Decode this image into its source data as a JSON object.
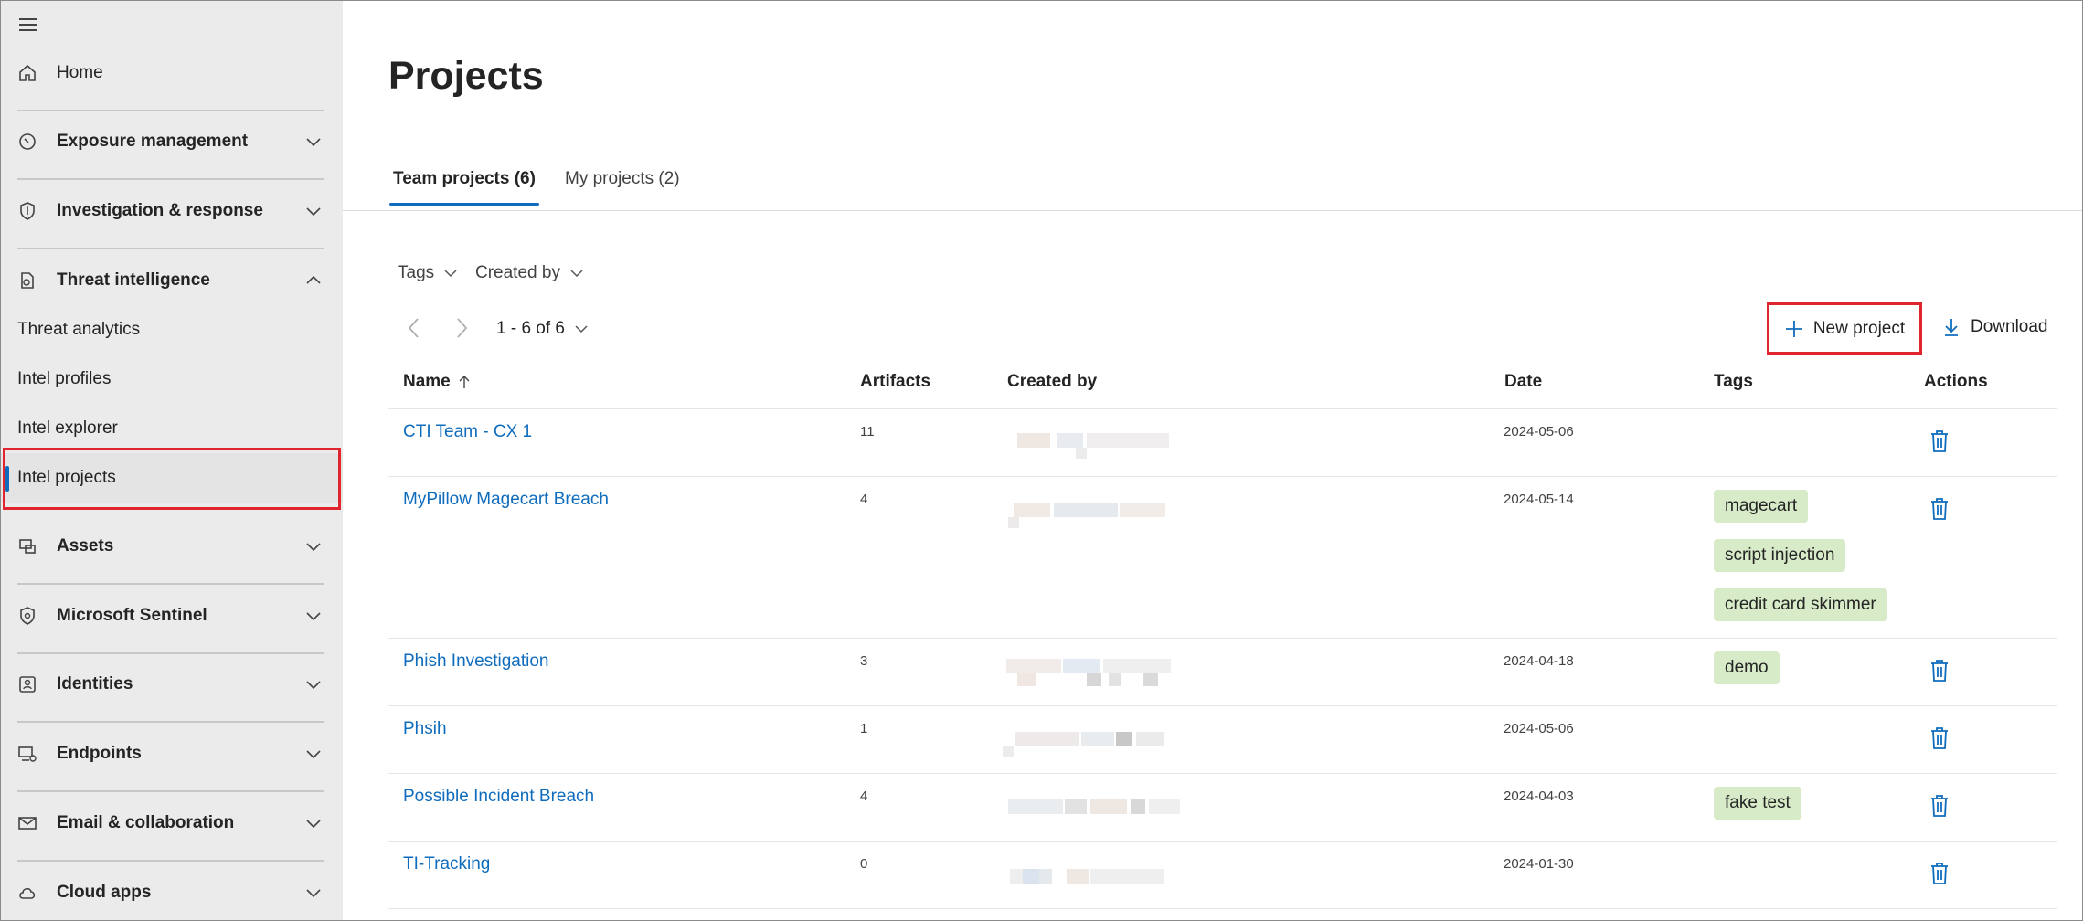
{
  "sidebar": {
    "home": "Home",
    "exposure": "Exposure management",
    "investigation": "Investigation & response",
    "threat_intel": "Threat intelligence",
    "threat_analytics": "Threat analytics",
    "intel_profiles": "Intel profiles",
    "intel_explorer": "Intel explorer",
    "intel_projects": "Intel projects",
    "assets": "Assets",
    "sentinel": "Microsoft Sentinel",
    "identities": "Identities",
    "endpoints": "Endpoints",
    "email": "Email & collaboration",
    "cloud_apps": "Cloud apps"
  },
  "page": {
    "title": "Projects"
  },
  "tabs": {
    "team": "Team projects (6)",
    "mine": "My projects (2)"
  },
  "filters": {
    "tags": "Tags",
    "created_by": "Created by"
  },
  "pager": {
    "range": "1 - 6 of 6"
  },
  "toolbar": {
    "new_project": "New project",
    "download": "Download"
  },
  "table": {
    "headers": {
      "name": "Name",
      "artifacts": "Artifacts",
      "created_by": "Created by",
      "date": "Date",
      "tags": "Tags",
      "actions": "Actions"
    },
    "rows": [
      {
        "name": "CTI Team - CX 1",
        "artifacts": "11",
        "date": "2024-05-06",
        "tags": []
      },
      {
        "name": "MyPillow Magecart Breach",
        "artifacts": "4",
        "date": "2024-05-14",
        "tags": [
          "magecart",
          "script injection",
          "credit card skimmer"
        ]
      },
      {
        "name": "Phish Investigation",
        "artifacts": "3",
        "date": "2024-04-18",
        "tags": [
          "demo"
        ]
      },
      {
        "name": "Phsih",
        "artifacts": "1",
        "date": "2024-05-06",
        "tags": []
      },
      {
        "name": "Possible Incident Breach",
        "artifacts": "4",
        "date": "2024-04-03",
        "tags": [
          "fake test"
        ]
      },
      {
        "name": "TI-Tracking",
        "artifacts": "0",
        "date": "2024-01-30",
        "tags": []
      }
    ]
  },
  "colors": {
    "accent": "#0f6cbd",
    "highlight": "#e0252e",
    "tag_bg": "#d7ebc8",
    "sidebar_bg": "#ebebeb"
  },
  "icons": {
    "menu": "hamburger-icon",
    "home": "home-icon",
    "sort": "arrow-up-icon",
    "add": "plus-icon",
    "download": "download-icon",
    "delete": "trash-icon"
  }
}
